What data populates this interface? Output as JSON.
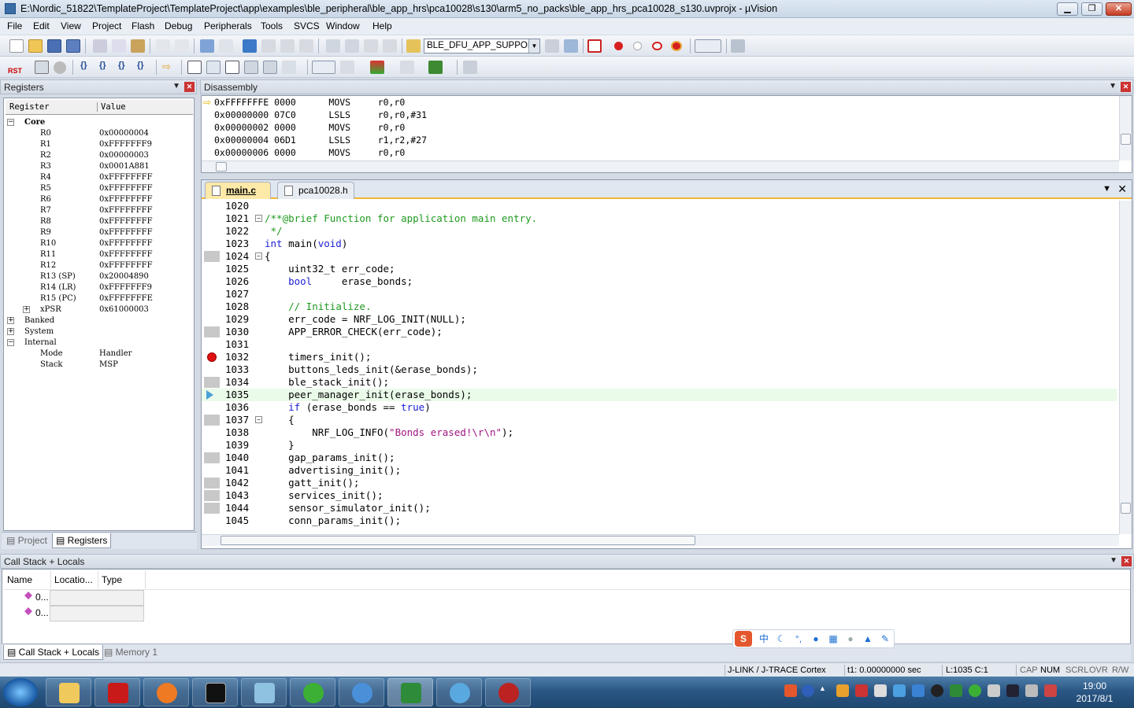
{
  "window": {
    "title": "E:\\Nordic_51822\\TemplateProject\\TemplateProject\\app\\examples\\ble_peripheral\\ble_app_hrs\\pca10028\\s130\\arm5_no_packs\\ble_app_hrs_pca10028_s130.uvprojx - µVision"
  },
  "menu": [
    "File",
    "Edit",
    "View",
    "Project",
    "Flash",
    "Debug",
    "Peripherals",
    "Tools",
    "SVCS",
    "Window",
    "Help"
  ],
  "toolbar": {
    "target": "BLE_DFU_APP_SUPPORT",
    "rst_label": "RST"
  },
  "registers": {
    "title": "Registers",
    "col_register": "Register",
    "col_value": "Value",
    "groups": [
      {
        "name": "Core",
        "expander": "−"
      },
      {
        "name": "Banked",
        "expander": "+"
      },
      {
        "name": "System",
        "expander": "+"
      },
      {
        "name": "Internal",
        "expander": "−"
      }
    ],
    "core": [
      {
        "name": "R0",
        "value": "0x00000004"
      },
      {
        "name": "R1",
        "value": "0xFFFFFFF9"
      },
      {
        "name": "R2",
        "value": "0x00000003"
      },
      {
        "name": "R3",
        "value": "0x0001A881"
      },
      {
        "name": "R4",
        "value": "0xFFFFFFFF"
      },
      {
        "name": "R5",
        "value": "0xFFFFFFFF"
      },
      {
        "name": "R6",
        "value": "0xFFFFFFFF"
      },
      {
        "name": "R7",
        "value": "0xFFFFFFFF"
      },
      {
        "name": "R8",
        "value": "0xFFFFFFFF"
      },
      {
        "name": "R9",
        "value": "0xFFFFFFFF"
      },
      {
        "name": "R10",
        "value": "0xFFFFFFFF"
      },
      {
        "name": "R11",
        "value": "0xFFFFFFFF"
      },
      {
        "name": "R12",
        "value": "0xFFFFFFFF"
      },
      {
        "name": "R13 (SP)",
        "value": "0x20004890"
      },
      {
        "name": "R14 (LR)",
        "value": "0xFFFFFFF9"
      },
      {
        "name": "R15 (PC)",
        "value": "0xFFFFFFFE"
      },
      {
        "name": "xPSR",
        "value": "0x61000003"
      }
    ],
    "internal": [
      {
        "name": "Mode",
        "value": "Handler"
      },
      {
        "name": "Stack",
        "value": "MSP"
      }
    ],
    "tabs": [
      "Project",
      "Registers"
    ]
  },
  "disassembly": {
    "title": "Disassembly",
    "lines": [
      "0xFFFFFFFE 0000      MOVS     r0,r0",
      "0x00000000 07C0      LSLS     r0,r0,#31",
      "0x00000002 0000      MOVS     r0,r0",
      "0x00000004 06D1      LSLS     r1,r2,#27",
      "0x00000006 0000      MOVS     r0,r0"
    ]
  },
  "editor": {
    "tabs": [
      "main.c",
      "pca10028.h"
    ],
    "lines": [
      {
        "n": "1020",
        "html": "",
        "g": ""
      },
      {
        "n": "1021",
        "html": "<span class='cm'>/**@brief Function for application main entry.</span>",
        "g": "",
        "f": "−"
      },
      {
        "n": "1022",
        "html": "<span class='cm'> */</span>",
        "g": ""
      },
      {
        "n": "1023",
        "html": "<span class='kw'>int</span> main(<span class='kw'>void</span>)",
        "g": ""
      },
      {
        "n": "1024",
        "html": "{",
        "g": "grey",
        "f": "−"
      },
      {
        "n": "1025",
        "html": "    uint32_t err_code;",
        "g": ""
      },
      {
        "n": "1026",
        "html": "    <span class='kw'>bool</span>     erase_bonds;",
        "g": ""
      },
      {
        "n": "1027",
        "html": "",
        "g": ""
      },
      {
        "n": "1028",
        "html": "    <span class='cm'>// Initialize.</span>",
        "g": ""
      },
      {
        "n": "1029",
        "html": "    err_code = NRF_LOG_INIT(NULL);",
        "g": ""
      },
      {
        "n": "1030",
        "html": "    APP_ERROR_CHECK(err_code);",
        "g": "grey"
      },
      {
        "n": "1031",
        "html": "",
        "g": ""
      },
      {
        "n": "1032",
        "html": "    timers_init();",
        "g": "bp"
      },
      {
        "n": "1033",
        "html": "    buttons_leds_init(&amp;erase_bonds);",
        "g": ""
      },
      {
        "n": "1034",
        "html": "    ble_stack_init();",
        "g": "grey"
      },
      {
        "n": "1035",
        "html": "    peer_manager_init(erase_bonds);",
        "g": "cur"
      },
      {
        "n": "1036",
        "html": "    <span class='kw'>if</span> (erase_bonds == <span class='kw'>true</span>)",
        "g": ""
      },
      {
        "n": "1037",
        "html": "    {",
        "g": "grey",
        "f": "−"
      },
      {
        "n": "1038",
        "html": "        NRF_LOG_INFO(<span class='st'>\"Bonds erased!\\r\\n\"</span>);",
        "g": ""
      },
      {
        "n": "1039",
        "html": "    }",
        "g": ""
      },
      {
        "n": "1040",
        "html": "    gap_params_init();",
        "g": "grey"
      },
      {
        "n": "1041",
        "html": "    advertising_init();",
        "g": ""
      },
      {
        "n": "1042",
        "html": "    gatt_init();",
        "g": "grey"
      },
      {
        "n": "1043",
        "html": "    services_init();",
        "g": "grey"
      },
      {
        "n": "1044",
        "html": "    sensor_simulator_init();",
        "g": "grey"
      },
      {
        "n": "1045",
        "html": "    conn_params_init();",
        "g": ""
      }
    ]
  },
  "callstack": {
    "title": "Call Stack + Locals",
    "cols": [
      "Name",
      "Locatio...",
      "Type"
    ],
    "rows": [
      "0...",
      "0..."
    ],
    "tabs": [
      "Call Stack + Locals",
      "Memory 1"
    ]
  },
  "status": {
    "debugger": "J-LINK / J-TRACE Cortex",
    "time": "t1: 0.00000000 sec",
    "pos": "L:1035 C:1",
    "cap": "CAP",
    "num": "NUM",
    "scrl": "SCRL",
    "ovr": "OVR",
    "rw": "R/W"
  },
  "ime": {
    "lang": "中"
  },
  "clock": {
    "time": "19:00",
    "date": "2017/8/1"
  }
}
